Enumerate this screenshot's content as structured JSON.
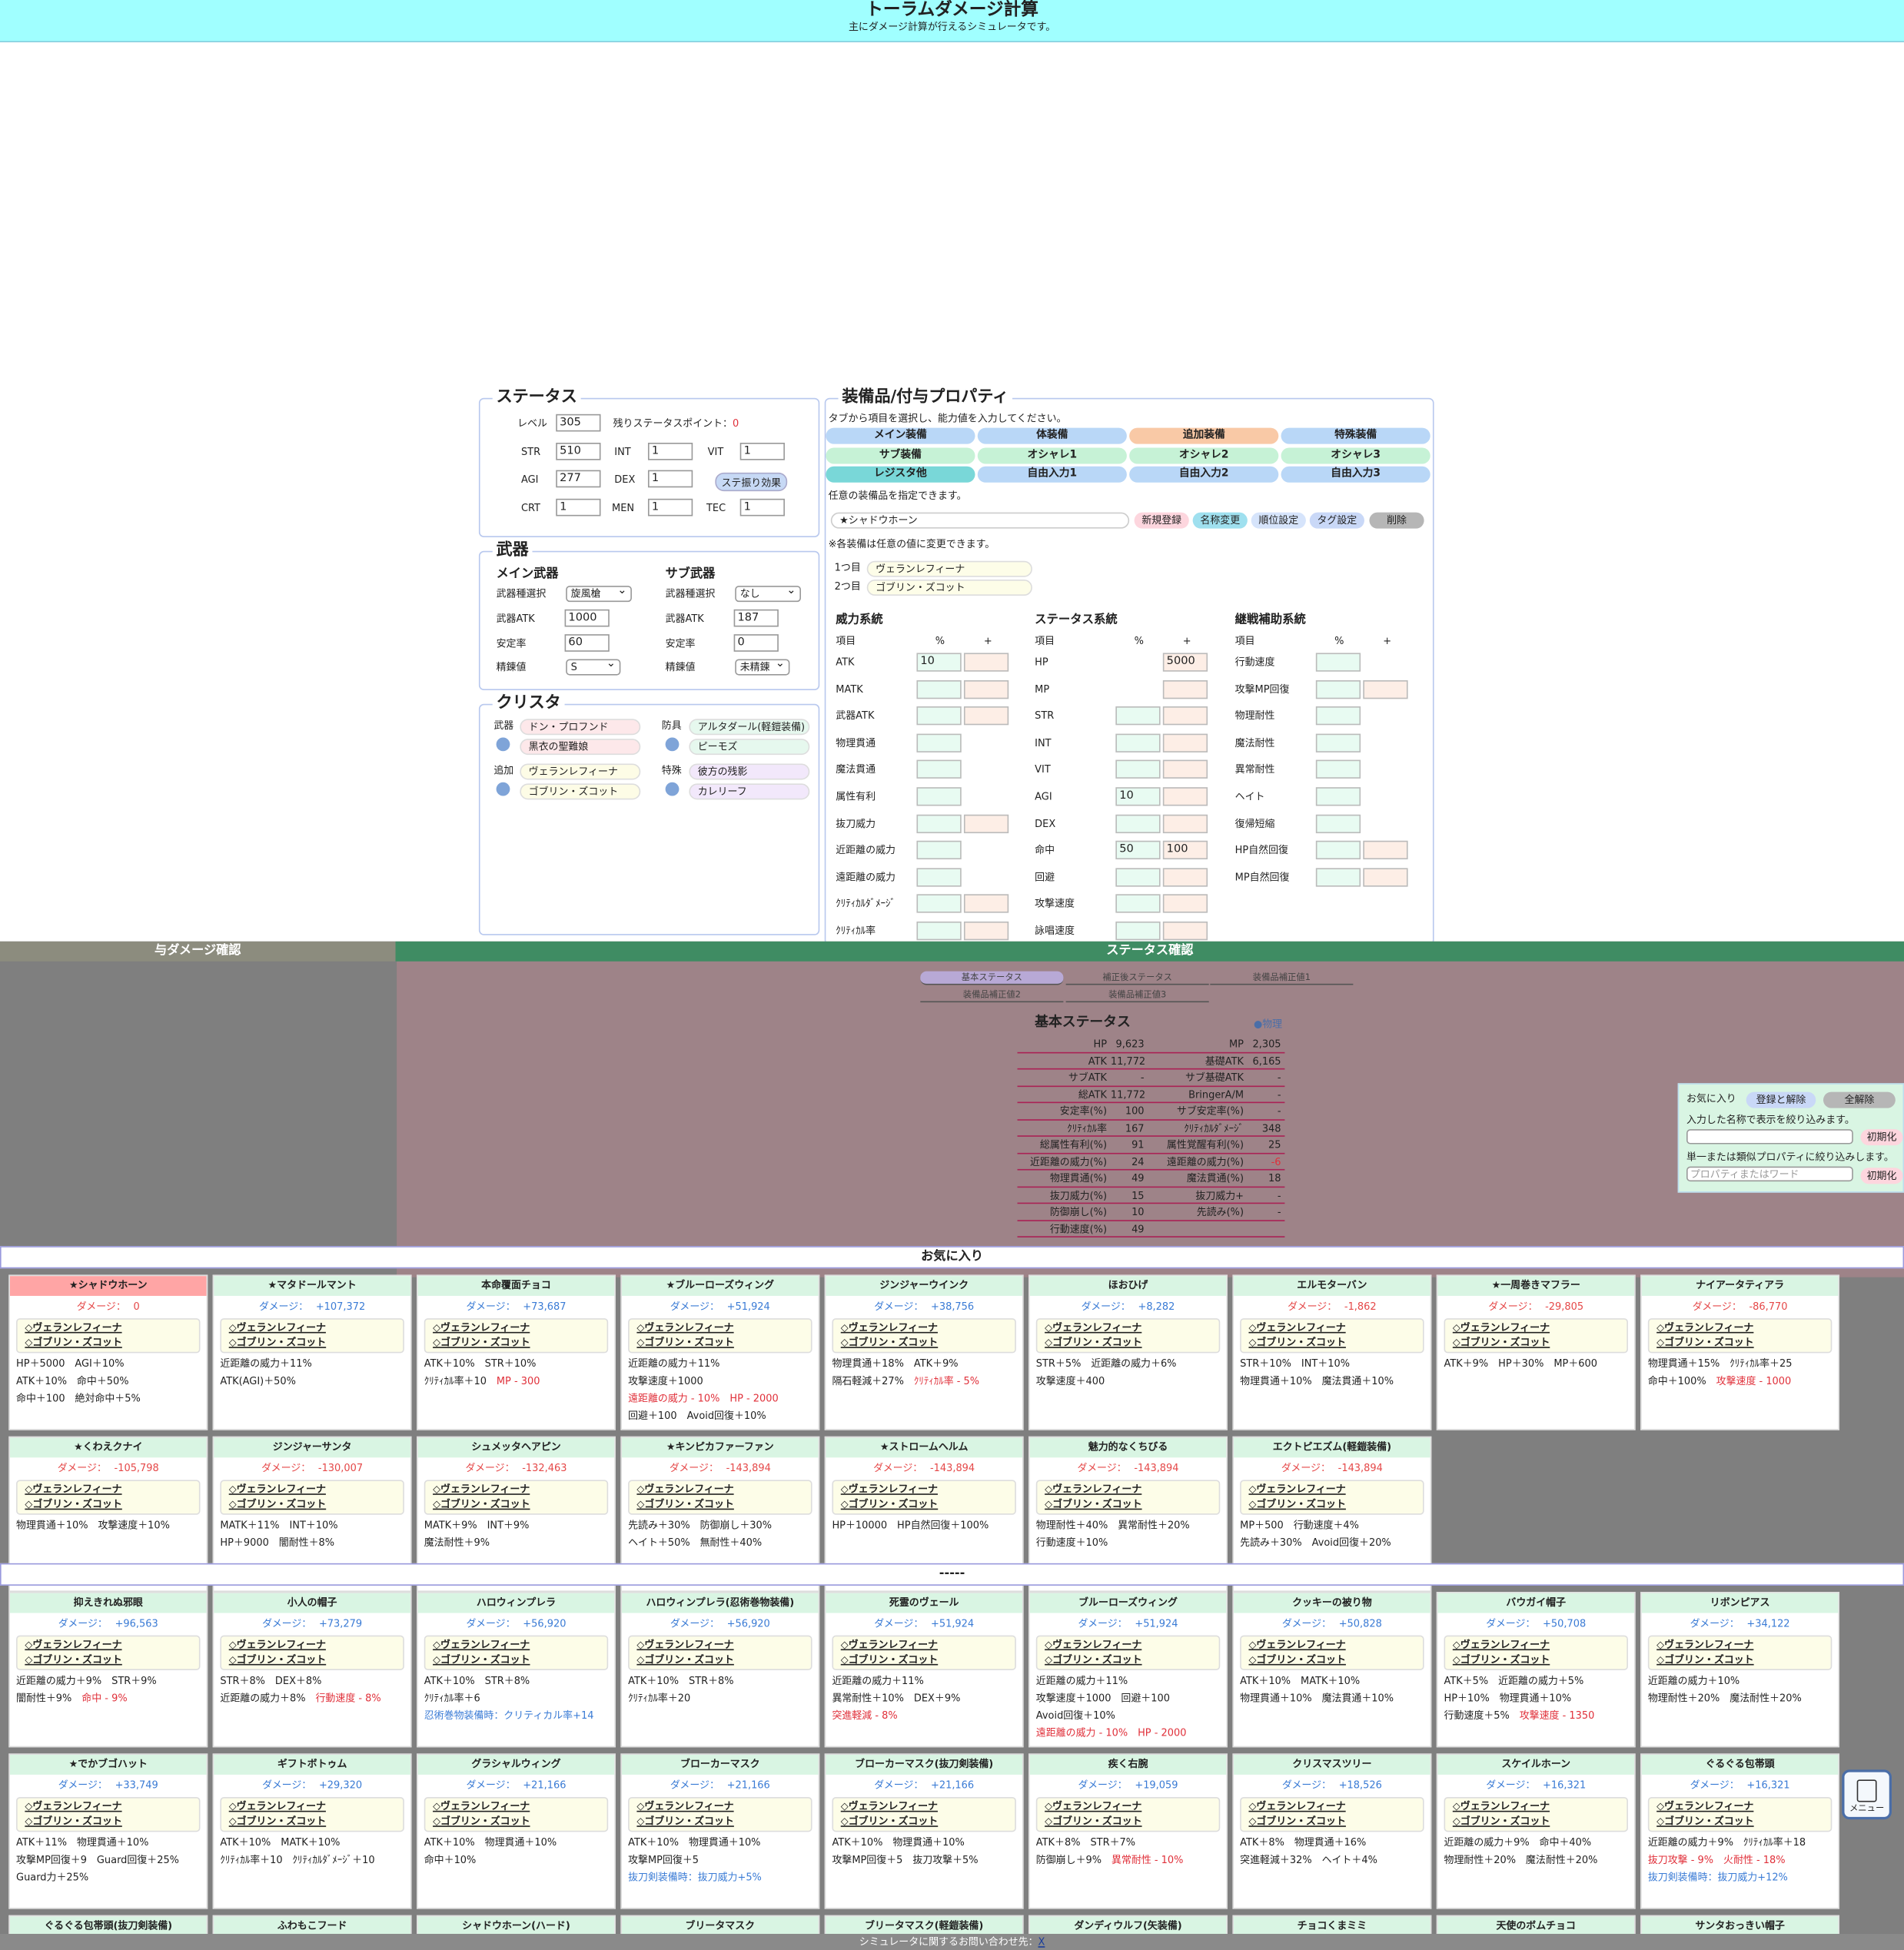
{
  "header": {
    "title": "トーラムダメージ計算",
    "subtitle": "主にダメージ計算が行えるシミュレータです。"
  },
  "status": {
    "legend": "ステータス",
    "level_label": "レベル",
    "level": "305",
    "remain_label": "残りステータスポイント：",
    "remain": "0",
    "rows": [
      {
        "a": "STR",
        "av": "510",
        "b": "INT",
        "bv": "1",
        "c": "VIT",
        "cv": "1"
      },
      {
        "a": "AGI",
        "av": "277",
        "b": "DEX",
        "bv": "1"
      },
      {
        "a": "CRT",
        "av": "1",
        "b": "MEN",
        "bv": "1",
        "c": "TEC",
        "cv": "1"
      }
    ],
    "effect_button": "ステ振り効果"
  },
  "weapon": {
    "legend": "武器",
    "main": {
      "title": "メイン武器",
      "type_label": "武器種選択",
      "type": "旋風槍",
      "atk_label": "武器ATK",
      "atk": "1000",
      "stab_label": "安定率",
      "stab": "60",
      "ref_label": "精錬値",
      "ref": "S"
    },
    "sub": {
      "title": "サブ武器",
      "type_label": "武器種選択",
      "type": "なし",
      "atk_label": "武器ATK",
      "atk": "187",
      "stab_label": "安定率",
      "stab": "0",
      "ref_label": "精錬値",
      "ref": "未精錬"
    }
  },
  "crysta": {
    "legend": "クリスタ",
    "weapon_label": "武器",
    "weapon": [
      "ドン・プロフンド",
      "黒衣の聖難娘"
    ],
    "armor_label": "防具",
    "armor": [
      "アルタダール(軽鎧装備)",
      "ピーモズ"
    ],
    "add_label": "追加",
    "add": [
      "ヴェランレフィーナ",
      "ゴブリン・ズコット"
    ],
    "sp_label": "特殊",
    "sp": [
      "彼方の残影",
      "カレリーフ"
    ]
  },
  "equip": {
    "legend": "装備品/付与プロパティ",
    "hint": "タブから項目を選択し、能力値を入力してください。",
    "tabs": [
      "メイン装備",
      "体装備",
      "追加装備",
      "特殊装備",
      "サブ装備",
      "オシャレ1",
      "オシャレ2",
      "オシャレ3",
      "レジスタ他",
      "自由入力1",
      "自由入力2",
      "自由入力3"
    ],
    "any_hint": "任意の装備品を指定できます。",
    "selected": "★シャドウホーン",
    "buttons": [
      "新規登録",
      "名称変更",
      "順位設定",
      "タグ設定",
      "削除"
    ],
    "note": "※各装備は任意の値に変更できます。",
    "slot1_label": "1つ目",
    "slot1": "ヴェランレフィーナ",
    "slot2_label": "2つ目",
    "slot2": "ゴブリン・ズコット",
    "col_titles": [
      "威力系統",
      "ステータス系統",
      "継戦補助系統"
    ],
    "h_item": "項目",
    "h_pct": "%",
    "h_plus": "+",
    "col1": [
      "ATK",
      "MATK",
      "武器ATK",
      "物理貫通",
      "魔法貫通",
      "属性有利",
      "抜刀威力",
      "近距離の威力",
      "遠距離の威力",
      "ｸﾘﾃｨｶﾙﾀﾞﾒｰｼﾞ",
      "ｸﾘﾃｨｶﾙ率"
    ],
    "col2": [
      "HP",
      "MP",
      "STR",
      "INT",
      "VIT",
      "AGI",
      "DEX",
      "命中",
      "回避",
      "攻撃速度",
      "詠唱速度"
    ],
    "col3": [
      "行動速度",
      "攻撃MP回復",
      "物理耐性",
      "魔法耐性",
      "異常耐性",
      "ヘイト",
      "復帰短縮",
      "HP自然回復",
      "MP自然回復"
    ],
    "v_atk": "10",
    "v_hp": "5000",
    "v_agi": "10",
    "v_hit1": "50",
    "v_hit2": "100"
  },
  "bars": {
    "left": "与ダメージ確認",
    "right": "ステータス確認"
  },
  "stat_tabs": [
    "基本ステータス",
    "補正後ステータス",
    "装備品補正値1",
    "装備品補正値2",
    "装備品補正値3"
  ],
  "basic": {
    "title": "基本ステータス",
    "tag": "●物理",
    "rows": [
      [
        "HP",
        "9,623",
        "MP",
        "2,305"
      ],
      [
        "ATK",
        "11,772",
        "基礎ATK",
        "6,165"
      ],
      [
        "サブATK",
        "-",
        "サブ基礎ATK",
        "-"
      ],
      [
        "総ATK",
        "11,772",
        "BringerA/M",
        "-"
      ],
      [
        "安定率(%)",
        "100",
        "サブ安定率(%)",
        "-"
      ],
      [
        "ｸﾘﾃｨｶﾙ率",
        "167",
        "ｸﾘﾃｨｶﾙﾀﾞﾒｰｼﾞ",
        "348"
      ],
      [
        "総属性有利(%)",
        "91",
        "属性覚醒有利(%)",
        "25"
      ],
      [
        "近距離の威力(%)",
        "24",
        "遠距離の威力(%)",
        "-6"
      ],
      [
        "物理貫通(%)",
        "49",
        "魔法貫通(%)",
        "18"
      ],
      [
        "抜刀威力(%)",
        "15",
        "抜刀威力+",
        "-"
      ],
      [
        "防御崩し(%)",
        "10",
        "先読み(%)",
        "-"
      ],
      [
        "行動速度(%)",
        "49",
        "",
        ""
      ]
    ]
  },
  "fav": {
    "label": "お気に入り",
    "reg_button": "登録と解除",
    "all_button": "全解除",
    "hint1": "入力した名称で表示を絞り込みます。",
    "reset": "初期化",
    "hint2": "単一または類似プロパティに絞り込みします。",
    "placeholder": "プロパティまたはワード"
  },
  "sections": {
    "fav": "お気に入り",
    "other": "-----"
  },
  "dmg_label": "ダメージ：",
  "fav_cards": [
    {
      "name": "★シャドウホーン",
      "dmg": "0",
      "s": "z",
      "sel": true,
      "p": [
        [
          "HP＋5000　AGI＋10%",
          ""
        ],
        [
          "ATK＋10%　命中＋50%",
          ""
        ],
        [
          "命中＋100　絶対命中＋5%",
          ""
        ]
      ]
    },
    {
      "name": "★マタドールマント",
      "dmg": "+107,372",
      "s": "p",
      "p": [
        [
          "近距離の威力＋11%",
          ""
        ],
        [
          "ATK(AGI)＋50%",
          ""
        ]
      ]
    },
    {
      "name": "本命覆面チョコ",
      "dmg": "+73,687",
      "s": "p",
      "p": [
        [
          "ATK＋10%　STR＋10%",
          ""
        ],
        [
          "ｸﾘﾃｨｶﾙ率＋10　",
          "MP - 300"
        ]
      ]
    },
    {
      "name": "★ブルーローズウィング",
      "dmg": "+51,924",
      "s": "p",
      "p": [
        [
          "近距離の威力＋11%",
          ""
        ],
        [
          "攻撃速度＋1000",
          ""
        ],
        [
          "",
          "遠距離の威力 - 10%　HP - 2000"
        ],
        [
          "回避＋100　Avoid回復＋10%",
          ""
        ]
      ]
    },
    {
      "name": "ジンジャーウインク",
      "dmg": "+38,756",
      "s": "p",
      "p": [
        [
          "物理貫通＋18%　ATK＋9%",
          ""
        ],
        [
          "隔石軽減＋27%　",
          "ｸﾘﾃｨｶﾙ率 - 5%"
        ]
      ]
    },
    {
      "name": "ほおひげ",
      "dmg": "+8,282",
      "s": "p",
      "p": [
        [
          "STR＋5%　近距離の威力＋6%",
          ""
        ],
        [
          "攻撃速度＋400",
          ""
        ]
      ]
    },
    {
      "name": "エルモターバン",
      "dmg": "-1,862",
      "s": "n",
      "p": [
        [
          "STR＋10%　INT＋10%",
          ""
        ],
        [
          "物理貫通＋10%　魔法貫通＋10%",
          ""
        ]
      ]
    },
    {
      "name": "★一周巻きマフラー",
      "dmg": "-29,805",
      "s": "n",
      "p": [
        [
          "ATK＋9%　HP＋30%　MP＋600",
          ""
        ]
      ]
    },
    {
      "name": "ナイアータティアラ",
      "dmg": "-86,770",
      "s": "n",
      "p": [
        [
          "物理貫通＋15%　ｸﾘﾃｨｶﾙ率＋25",
          ""
        ],
        [
          "命中＋100%　",
          "攻撃速度 - 1000"
        ]
      ]
    },
    {
      "name": "★くわえクナイ",
      "dmg": "-105,798",
      "s": "n",
      "p": [
        [
          "物理貫通＋10%　攻撃速度＋10%",
          ""
        ]
      ]
    },
    {
      "name": "ジンジャーサンタ",
      "dmg": "-130,007",
      "s": "n",
      "p": [
        [
          "MATK＋11%　INT＋10%",
          ""
        ],
        [
          "HP＋9000　闇耐性＋8%",
          ""
        ]
      ]
    },
    {
      "name": "シュメッタヘアピン",
      "dmg": "-132,463",
      "s": "n",
      "p": [
        [
          "MATK＋9%　INT＋9%",
          ""
        ],
        [
          "魔法耐性＋9%",
          ""
        ]
      ]
    },
    {
      "name": "★キンピカファーファン",
      "dmg": "-143,894",
      "s": "n",
      "p": [
        [
          "先読み＋30%　防御崩し＋30%",
          ""
        ],
        [
          "ヘイト＋50%　無耐性＋40%",
          ""
        ]
      ]
    },
    {
      "name": "★ストロームヘルム",
      "dmg": "-143,894",
      "s": "n",
      "p": [
        [
          "HP＋10000　HP自然回復＋100%",
          ""
        ]
      ]
    },
    {
      "name": "魅力的なくちびる",
      "dmg": "-143,894",
      "s": "n",
      "p": [
        [
          "物理耐性＋40%　異常耐性＋20%",
          ""
        ],
        [
          "行動速度＋10%",
          ""
        ]
      ]
    },
    {
      "name": "エクトピエズム(軽鎧装備)",
      "dmg": "-143,894",
      "s": "n",
      "p": [
        [
          "MP＋500　行動速度＋4%",
          ""
        ],
        [
          "先読み＋30%　Avoid回復＋20%",
          ""
        ]
      ]
    }
  ],
  "other_cards": [
    {
      "name": "抑えきれぬ邪眼",
      "dmg": "+96,563",
      "s": "p",
      "p": [
        [
          "近距離の威力＋9%　STR＋9%",
          ""
        ],
        [
          "闇耐性＋9%　",
          "命中 - 9%"
        ]
      ]
    },
    {
      "name": "小人の帽子",
      "dmg": "+73,279",
      "s": "p",
      "p": [
        [
          "STR＋8%　DEX＋8%",
          ""
        ],
        [
          "近距離の威力＋8%　",
          "行動速度 - 8%"
        ]
      ]
    },
    {
      "name": "ハロウィンプレラ",
      "dmg": "+56,920",
      "s": "p",
      "p": [
        [
          "ATK＋10%　STR＋8%",
          ""
        ],
        [
          "ｸﾘﾃｨｶﾙ率＋6",
          ""
        ],
        [
          "忍術巻物装備時：クリティカル率+14",
          "b"
        ]
      ]
    },
    {
      "name": "ハロウィンプレラ(忍術巻物装備)",
      "dmg": "+56,920",
      "s": "p",
      "p": [
        [
          "ATK＋10%　STR＋8%",
          ""
        ],
        [
          "ｸﾘﾃｨｶﾙ率＋20",
          ""
        ]
      ]
    },
    {
      "name": "死霊のヴェール",
      "dmg": "+51,924",
      "s": "p",
      "p": [
        [
          "近距離の威力＋11%",
          ""
        ],
        [
          "異常耐性＋10%　DEX＋9%",
          ""
        ],
        [
          "",
          "突進軽減 - 8%"
        ]
      ]
    },
    {
      "name": "ブルーローズウィング",
      "dmg": "+51,924",
      "s": "p",
      "p": [
        [
          "近距離の威力＋11%",
          ""
        ],
        [
          "攻撃速度＋1000　回避＋100",
          ""
        ],
        [
          "Avoid回復＋10%",
          ""
        ],
        [
          "",
          "遠距離の威力 - 10%　HP - 2000"
        ]
      ]
    },
    {
      "name": "クッキーの被り物",
      "dmg": "+50,828",
      "s": "p",
      "p": [
        [
          "ATK＋10%　MATK＋10%",
          ""
        ],
        [
          "物理貫通＋10%　魔法貫通＋10%",
          ""
        ]
      ]
    },
    {
      "name": "バウガイ帽子",
      "dmg": "+50,708",
      "s": "p",
      "p": [
        [
          "ATK＋5%　近距離の威力＋5%",
          ""
        ],
        [
          "HP＋10%　物理貫通＋10%",
          ""
        ],
        [
          "行動速度＋5%　",
          "攻撃速度 - 1350"
        ]
      ]
    },
    {
      "name": "リボンピアス",
      "dmg": "+34,122",
      "s": "p",
      "p": [
        [
          "近距離の威力＋10%",
          ""
        ],
        [
          "物理耐性＋20%　魔法耐性＋20%",
          ""
        ]
      ]
    },
    {
      "name": "★でかブゴハット",
      "dmg": "+33,749",
      "s": "p",
      "p": [
        [
          "ATK＋11%　物理貫通＋10%",
          ""
        ],
        [
          "攻撃MP回復＋9　Guard回復＋25%",
          ""
        ],
        [
          "Guard力＋25%",
          ""
        ]
      ]
    },
    {
      "name": "ギフトボトゥム",
      "dmg": "+29,320",
      "s": "p",
      "p": [
        [
          "ATK＋10%　MATK＋10%",
          ""
        ],
        [
          "ｸﾘﾃｨｶﾙ率＋10　ｸﾘﾃｨｶﾙﾀﾞﾒｰｼﾞ＋10",
          ""
        ]
      ]
    },
    {
      "name": "グラシャルウィング",
      "dmg": "+21,166",
      "s": "p",
      "p": [
        [
          "ATK＋10%　物理貫通＋10%",
          ""
        ],
        [
          "命中＋10%",
          ""
        ]
      ]
    },
    {
      "name": "ブローカーマスク",
      "dmg": "+21,166",
      "s": "p",
      "p": [
        [
          "ATK＋10%　物理貫通＋10%",
          ""
        ],
        [
          "攻撃MP回復＋5",
          ""
        ],
        [
          "抜刀剣装備時：抜刀威力+5%",
          "b"
        ]
      ]
    },
    {
      "name": "ブローカーマスク(抜刀剣装備)",
      "dmg": "+21,166",
      "s": "p",
      "p": [
        [
          "ATK＋10%　物理貫通＋10%",
          ""
        ],
        [
          "攻撃MP回復＋5　抜刀攻撃＋5%",
          ""
        ]
      ]
    },
    {
      "name": "疾く右腕",
      "dmg": "+19,059",
      "s": "p",
      "p": [
        [
          "ATK＋8%　STR＋7%",
          ""
        ],
        [
          "防御崩し＋9%　",
          "異常耐性 - 10%"
        ]
      ]
    },
    {
      "name": "クリスマスツリー",
      "dmg": "+18,526",
      "s": "p",
      "p": [
        [
          "ATK＋8%　物理貫通＋16%",
          ""
        ],
        [
          "突進軽減＋32%　ヘイト＋4%",
          ""
        ]
      ]
    },
    {
      "name": "スケイルホーン",
      "dmg": "+16,321",
      "s": "p",
      "p": [
        [
          "近距離の威力＋9%　命中＋40%",
          ""
        ],
        [
          "物理耐性＋20%　魔法耐性＋20%",
          ""
        ]
      ]
    },
    {
      "name": "ぐるぐる包帯頭",
      "dmg": "+16,321",
      "s": "p",
      "p": [
        [
          "近距離の威力＋9%　ｸﾘﾃｨｶﾙ率＋18",
          ""
        ],
        [
          "",
          "抜刀攻撃 - 9%　火耐性 - 18%"
        ],
        [
          "抜刀剣装備時：抜刀威力+12%",
          "b"
        ]
      ]
    },
    {
      "name": "ぐるぐる包帯頭(抜刀剣装備)",
      "dmg": "",
      "s": "p",
      "p": []
    },
    {
      "name": "ふわもこフード",
      "dmg": "",
      "s": "p",
      "p": []
    },
    {
      "name": "シャドウホーン(ハード)",
      "dmg": "",
      "s": "n",
      "p": []
    },
    {
      "name": "ブリータマスク",
      "dmg": "",
      "s": "n",
      "p": []
    },
    {
      "name": "ブリータマスク(軽鎧装備)",
      "dmg": "",
      "s": "n",
      "p": []
    },
    {
      "name": "ダンディウルフ(矢装備)",
      "dmg": "",
      "s": "n",
      "p": []
    },
    {
      "name": "チョコくまミミ",
      "dmg": "",
      "s": "n",
      "p": []
    },
    {
      "name": "天使のボムチョコ",
      "dmg": "",
      "s": "n",
      "p": []
    },
    {
      "name": "サンタおっきい帽子",
      "dmg": "",
      "s": "n",
      "p": []
    }
  ],
  "contents": [
    "ヴェランレフィーナ",
    "ゴブリン・ズコット"
  ],
  "footer": {
    "text": "シミュレータに関するお問い合わせ先：",
    "link": "X"
  },
  "menu_label": "メニュー"
}
